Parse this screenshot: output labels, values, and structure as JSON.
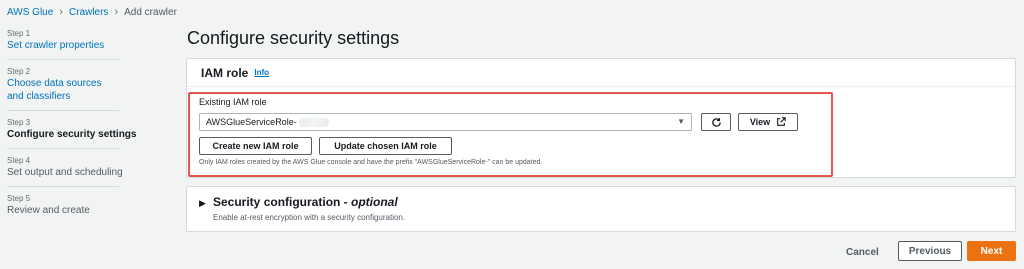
{
  "breadcrumb": {
    "items": [
      "AWS Glue",
      "Crawlers",
      "Add crawler"
    ]
  },
  "steps": [
    {
      "number": "Step 1",
      "label": "Set crawler properties",
      "state": "link"
    },
    {
      "number": "Step 2",
      "label": "Choose data sources and classifiers",
      "state": "link"
    },
    {
      "number": "Step 3",
      "label": "Configure security settings",
      "state": "active"
    },
    {
      "number": "Step 4",
      "label": "Set output and scheduling",
      "state": "disabled"
    },
    {
      "number": "Step 5",
      "label": "Review and create",
      "state": "disabled"
    }
  ],
  "page_title": "Configure security settings",
  "iam": {
    "title": "IAM role",
    "info": "Info",
    "field_label": "Existing IAM role",
    "selected_value": "AWSGlueServiceRole-",
    "view_label": "View",
    "create_label": "Create new IAM role",
    "update_label": "Update chosen IAM role",
    "note": "Only IAM roles created by the AWS Glue console and have the prefix \"AWSGlueServiceRole-\" can be updated."
  },
  "security": {
    "title": "Security configuration - ",
    "title_optional": "optional",
    "description": "Enable at-rest encryption with a security configuration."
  },
  "footer": {
    "cancel": "Cancel",
    "previous": "Previous",
    "next": "Next"
  },
  "colors": {
    "link": "#0073bb",
    "primary": "#ec7211",
    "highlight": "#e0584c"
  }
}
